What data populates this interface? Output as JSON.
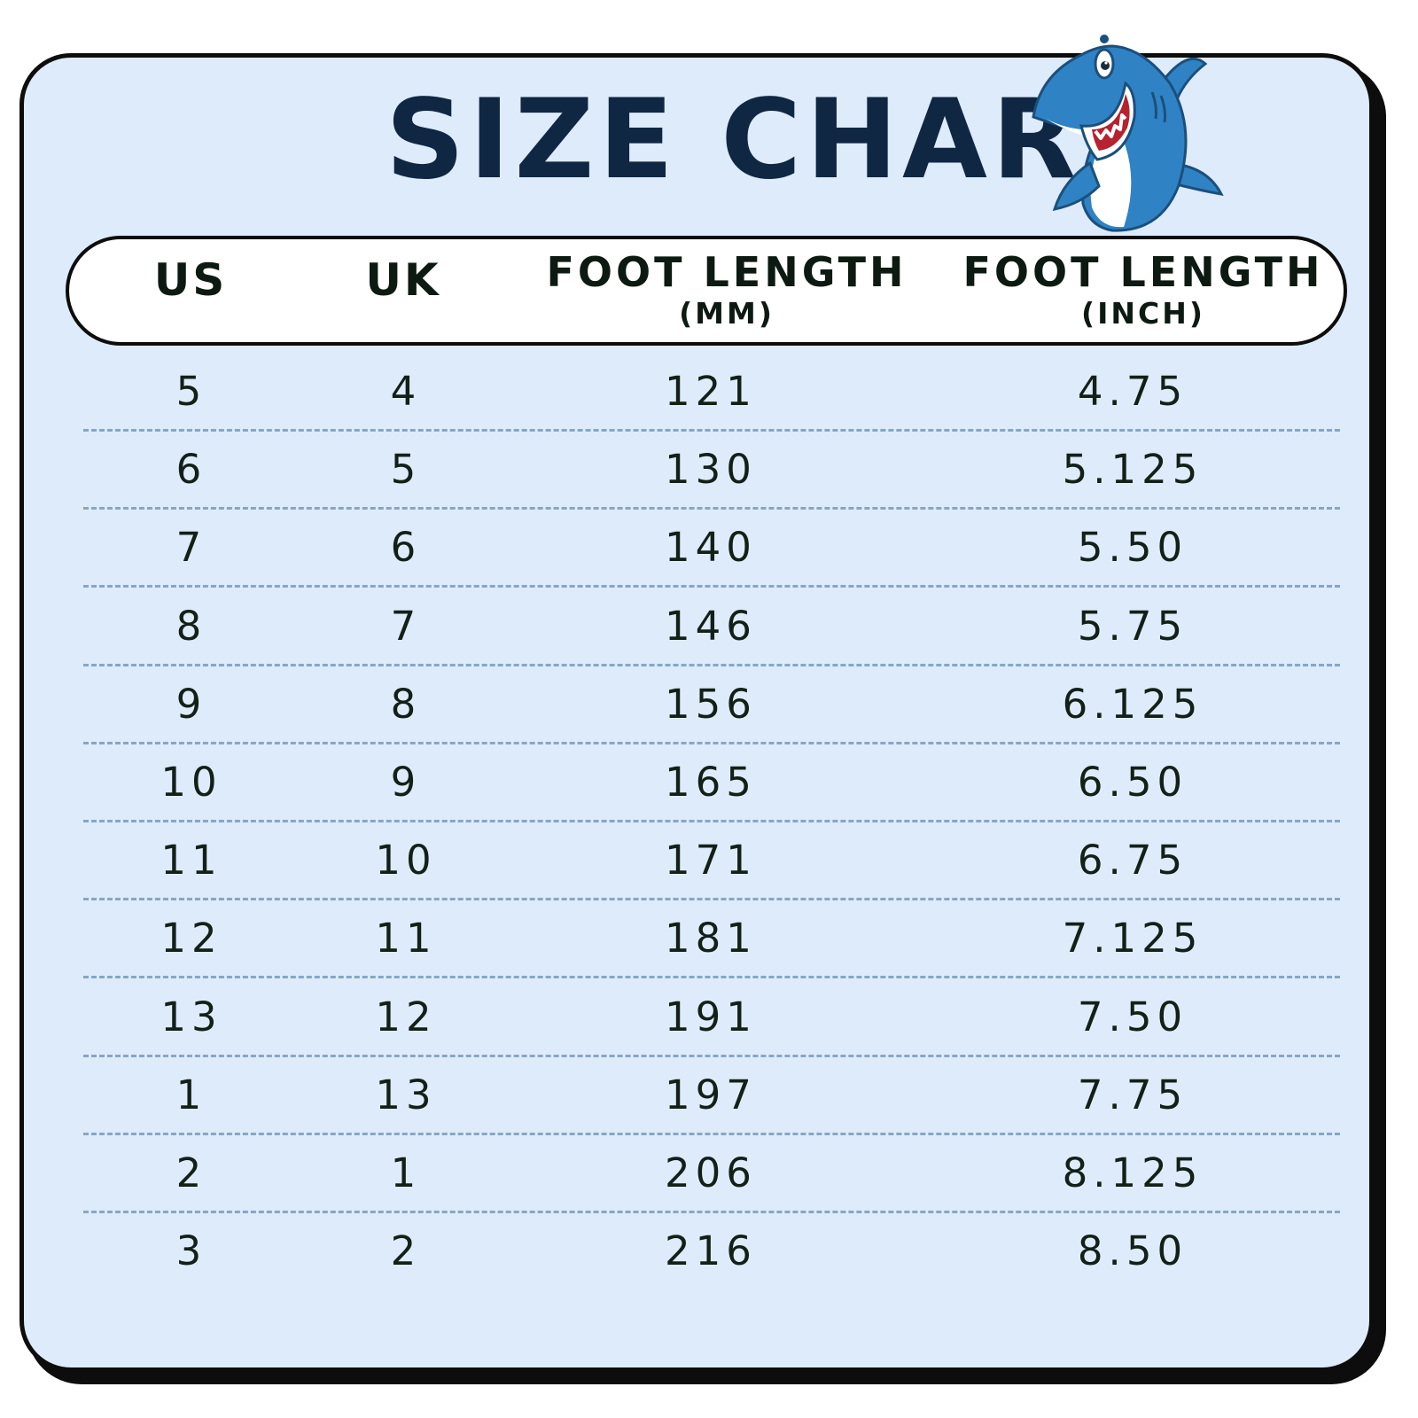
{
  "title": "SIZE CHART",
  "mascot": "cartoon-shark",
  "colors": {
    "background": "#deebfa",
    "title": "#0f2743",
    "text": "#132018",
    "border": "#0d0d0d",
    "divider": "#86a6c6",
    "shark_body": "#2f83c5"
  },
  "header": {
    "us": "US",
    "uk": "UK",
    "mm_title": "FOOT LENGTH",
    "mm_unit": "(MM)",
    "inch_title": "FOOT LENGTH",
    "inch_unit": "(INCH)"
  },
  "rows": [
    {
      "us": "5",
      "uk": "4",
      "mm": "121",
      "inch": "4.75"
    },
    {
      "us": "6",
      "uk": "5",
      "mm": "130",
      "inch": "5.125"
    },
    {
      "us": "7",
      "uk": "6",
      "mm": "140",
      "inch": "5.50"
    },
    {
      "us": "8",
      "uk": "7",
      "mm": "146",
      "inch": "5.75"
    },
    {
      "us": "9",
      "uk": "8",
      "mm": "156",
      "inch": "6.125"
    },
    {
      "us": "10",
      "uk": "9",
      "mm": "165",
      "inch": "6.50"
    },
    {
      "us": "11",
      "uk": "10",
      "mm": "171",
      "inch": "6.75"
    },
    {
      "us": "12",
      "uk": "11",
      "mm": "181",
      "inch": "7.125"
    },
    {
      "us": "13",
      "uk": "12",
      "mm": "191",
      "inch": "7.50"
    },
    {
      "us": "1",
      "uk": "13",
      "mm": "197",
      "inch": "7.75"
    },
    {
      "us": "2",
      "uk": "1",
      "mm": "206",
      "inch": "8.125"
    },
    {
      "us": "3",
      "uk": "2",
      "mm": "216",
      "inch": "8.50"
    }
  ]
}
